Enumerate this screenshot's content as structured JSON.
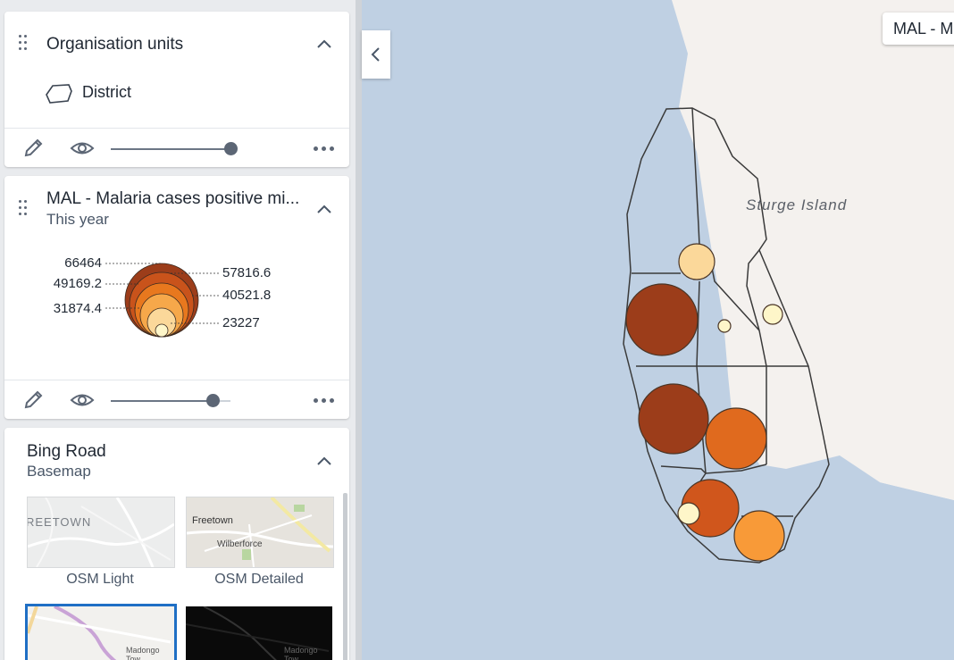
{
  "org_units_card": {
    "title": "Organisation units",
    "item_label": "District",
    "item_icon": "polygon-icon",
    "opacity_percent": 100
  },
  "malaria_card": {
    "title": "MAL - Malaria cases positive mi...",
    "subtitle": "This year",
    "opacity_percent": 85,
    "legend": {
      "left_labels": [
        "66464",
        "49169.2",
        "31874.4"
      ],
      "right_labels": [
        "57816.6",
        "40521.8",
        "23227"
      ],
      "colors": [
        "#9c3d1a",
        "#c9531b",
        "#e8781e",
        "#f6a84a",
        "#fbd89a",
        "#fef6c9"
      ]
    }
  },
  "basemap_card": {
    "title": "Bing Road",
    "subtitle": "Basemap",
    "options": [
      {
        "name": "OSM Light",
        "thumb_text": "REETOWN",
        "selected": false
      },
      {
        "name": "OSM Detailed",
        "thumb_text": "Freetown",
        "selected": false
      },
      {
        "name": "",
        "thumb_text": "Madongo Tow",
        "selected": true
      },
      {
        "name": "",
        "thumb_text": "Madongo Tow",
        "selected": false
      }
    ],
    "detailed_thumb_extra": "Wilberforce"
  },
  "map": {
    "island_label": "Sturge Island",
    "layer_label": "MAL - M",
    "water_color": "#bfd0e3",
    "land_color": "#f4f1ee",
    "boundary_color": "#3a3a3a",
    "bubbles": [
      {
        "name": "bubble-1",
        "value_class": 4,
        "color": "#fbd89a"
      },
      {
        "name": "bubble-2",
        "value_class": 0,
        "color": "#9c3d1a"
      },
      {
        "name": "bubble-3",
        "value_class": 5,
        "color": "#fef6c9"
      },
      {
        "name": "bubble-4",
        "value_class": 5,
        "color": "#fef6c9"
      },
      {
        "name": "bubble-5",
        "value_class": 0,
        "color": "#9c3d1a"
      },
      {
        "name": "bubble-6",
        "value_class": 2,
        "color": "#e06a1e"
      },
      {
        "name": "bubble-7",
        "value_class": 1,
        "color": "#d0561c"
      },
      {
        "name": "bubble-8",
        "value_class": 5,
        "color": "#fef6c9"
      },
      {
        "name": "bubble-9",
        "value_class": 3,
        "color": "#f89a38"
      }
    ]
  }
}
